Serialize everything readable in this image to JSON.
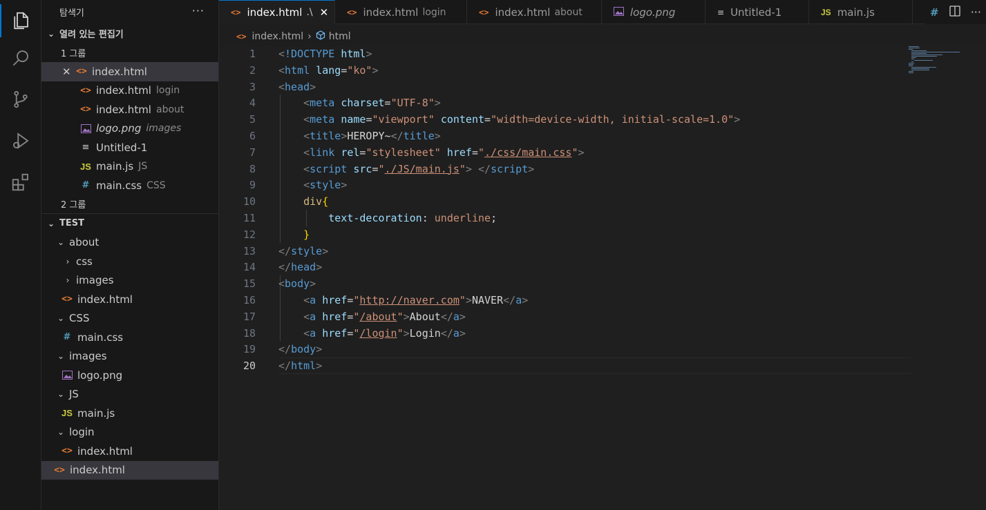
{
  "sidebar": {
    "title": "탐색기",
    "open_editors": {
      "header": "열려 있는 편집기",
      "group1": "1 그룹",
      "group2": "2 그룹",
      "items": [
        {
          "name": "index.html",
          "desc": "",
          "icon": "html-icon"
        },
        {
          "name": "index.html",
          "desc": "login",
          "icon": "html-icon"
        },
        {
          "name": "index.html",
          "desc": "about",
          "icon": "html-icon"
        },
        {
          "name": "logo.png",
          "desc": "images",
          "icon": "image-icon"
        },
        {
          "name": "Untitled-1",
          "desc": "",
          "icon": "text-file-icon"
        },
        {
          "name": "main.js",
          "desc": "JS",
          "icon": "js-icon"
        },
        {
          "name": "main.css",
          "desc": "CSS",
          "icon": "css-icon"
        }
      ]
    },
    "folder": {
      "header": "TEST",
      "items": [
        {
          "label": "about"
        },
        {
          "label": "css"
        },
        {
          "label": "images"
        },
        {
          "label": "index.html"
        },
        {
          "label": "CSS"
        },
        {
          "label": "main.css"
        },
        {
          "label": "images"
        },
        {
          "label": "logo.png"
        },
        {
          "label": "JS"
        },
        {
          "label": "main.js"
        },
        {
          "label": "login"
        },
        {
          "label": "index.html"
        },
        {
          "label": "index.html"
        }
      ]
    }
  },
  "tabs": [
    {
      "label": "index.html",
      "desc": ".\\",
      "icon": "html-icon"
    },
    {
      "label": "index.html",
      "desc": "login",
      "icon": "html-icon"
    },
    {
      "label": "index.html",
      "desc": "about",
      "icon": "html-icon"
    },
    {
      "label": "logo.png",
      "desc": "",
      "icon": "image-icon"
    },
    {
      "label": "Untitled-1",
      "desc": "",
      "icon": "text-file-icon"
    },
    {
      "label": "main.js",
      "desc": "",
      "icon": "js-icon"
    }
  ],
  "tab_icon_labels": {
    "html": "<>",
    "js": "JS",
    "css": "#",
    "txt": "≡",
    "close": "✕"
  },
  "breadcrumb": {
    "file": "index.html",
    "symbol": "html"
  },
  "editor": {
    "current_line": 20,
    "lines": [
      [
        [
          "t-punc",
          "<"
        ],
        [
          "t-tag",
          "!DOCTYPE"
        ],
        [
          "t-txt",
          " "
        ],
        [
          "t-attr",
          "html"
        ],
        [
          "t-punc",
          ">"
        ]
      ],
      [
        [
          "t-punc",
          "<"
        ],
        [
          "t-tag",
          "html"
        ],
        [
          "t-txt",
          " "
        ],
        [
          "t-attr",
          "lang"
        ],
        [
          "t-txt",
          "="
        ],
        [
          "t-str",
          "\"ko\""
        ],
        [
          "t-punc",
          ">"
        ]
      ],
      [
        [
          "t-punc",
          "<"
        ],
        [
          "t-tag",
          "head"
        ],
        [
          "t-punc",
          ">"
        ]
      ],
      [
        [
          "t-txt",
          "    "
        ],
        [
          "t-punc",
          "<"
        ],
        [
          "t-tag",
          "meta"
        ],
        [
          "t-txt",
          " "
        ],
        [
          "t-attr",
          "charset"
        ],
        [
          "t-txt",
          "="
        ],
        [
          "t-str",
          "\"UTF-8\""
        ],
        [
          "t-punc",
          ">"
        ]
      ],
      [
        [
          "t-txt",
          "    "
        ],
        [
          "t-punc",
          "<"
        ],
        [
          "t-tag",
          "meta"
        ],
        [
          "t-txt",
          " "
        ],
        [
          "t-attr",
          "name"
        ],
        [
          "t-txt",
          "="
        ],
        [
          "t-str",
          "\"viewport\""
        ],
        [
          "t-txt",
          " "
        ],
        [
          "t-attr",
          "content"
        ],
        [
          "t-txt",
          "="
        ],
        [
          "t-str",
          "\"width=device-width, initial-scale=1.0\""
        ],
        [
          "t-punc",
          ">"
        ]
      ],
      [
        [
          "t-txt",
          "    "
        ],
        [
          "t-punc",
          "<"
        ],
        [
          "t-tag",
          "title"
        ],
        [
          "t-punc",
          ">"
        ],
        [
          "t-txt",
          "HEROPY~"
        ],
        [
          "t-punc",
          "</"
        ],
        [
          "t-tag",
          "title"
        ],
        [
          "t-punc",
          ">"
        ]
      ],
      [
        [
          "t-txt",
          "    "
        ],
        [
          "t-punc",
          "<"
        ],
        [
          "t-tag",
          "link"
        ],
        [
          "t-txt",
          " "
        ],
        [
          "t-attr",
          "rel"
        ],
        [
          "t-txt",
          "="
        ],
        [
          "t-str",
          "\"stylesheet\""
        ],
        [
          "t-txt",
          " "
        ],
        [
          "t-attr",
          "href"
        ],
        [
          "t-txt",
          "="
        ],
        [
          "t-str",
          "\""
        ],
        [
          "t-str t-ul",
          "./css/main.css"
        ],
        [
          "t-str",
          "\""
        ],
        [
          "t-punc",
          ">"
        ]
      ],
      [
        [
          "t-txt",
          "    "
        ],
        [
          "t-punc",
          "<"
        ],
        [
          "t-tag",
          "script"
        ],
        [
          "t-txt",
          " "
        ],
        [
          "t-attr",
          "src"
        ],
        [
          "t-txt",
          "="
        ],
        [
          "t-str",
          "\""
        ],
        [
          "t-str t-ul",
          "./JS/main.js"
        ],
        [
          "t-str",
          "\""
        ],
        [
          "t-punc",
          ">"
        ],
        [
          "t-txt",
          " "
        ],
        [
          "t-punc",
          "</"
        ],
        [
          "t-tag",
          "script"
        ],
        [
          "t-punc",
          ">"
        ]
      ],
      [
        [
          "t-txt",
          "    "
        ],
        [
          "t-punc",
          "<"
        ],
        [
          "t-tag",
          "style"
        ],
        [
          "t-punc",
          ">"
        ]
      ],
      [
        [
          "t-txt",
          "    "
        ],
        [
          "t-sel",
          "div"
        ],
        [
          "t-brace",
          "{"
        ]
      ],
      [
        [
          "t-txt",
          "        "
        ],
        [
          "t-attr",
          "text-decoration"
        ],
        [
          "t-txt",
          ": "
        ],
        [
          "t-val",
          "underline"
        ],
        [
          "t-txt",
          ";"
        ]
      ],
      [
        [
          "t-txt",
          "    "
        ],
        [
          "t-brace",
          "}"
        ]
      ],
      [
        [
          "t-punc",
          "</"
        ],
        [
          "t-tag",
          "style"
        ],
        [
          "t-punc",
          ">"
        ]
      ],
      [
        [
          "t-punc",
          "</"
        ],
        [
          "t-tag",
          "head"
        ],
        [
          "t-punc",
          ">"
        ]
      ],
      [
        [
          "t-punc",
          "<"
        ],
        [
          "t-tag",
          "body"
        ],
        [
          "t-punc",
          ">"
        ]
      ],
      [
        [
          "t-txt",
          "    "
        ],
        [
          "t-punc",
          "<"
        ],
        [
          "t-tag",
          "a"
        ],
        [
          "t-txt",
          " "
        ],
        [
          "t-attr",
          "href"
        ],
        [
          "t-txt",
          "="
        ],
        [
          "t-str",
          "\""
        ],
        [
          "t-str t-ul",
          "http://naver.com"
        ],
        [
          "t-str",
          "\""
        ],
        [
          "t-punc",
          ">"
        ],
        [
          "t-txt",
          "NAVER"
        ],
        [
          "t-punc",
          "</"
        ],
        [
          "t-tag",
          "a"
        ],
        [
          "t-punc",
          ">"
        ]
      ],
      [
        [
          "t-txt",
          "    "
        ],
        [
          "t-punc",
          "<"
        ],
        [
          "t-tag",
          "a"
        ],
        [
          "t-txt",
          " "
        ],
        [
          "t-attr",
          "href"
        ],
        [
          "t-txt",
          "="
        ],
        [
          "t-str",
          "\""
        ],
        [
          "t-str t-ul",
          "/about"
        ],
        [
          "t-str",
          "\""
        ],
        [
          "t-punc",
          ">"
        ],
        [
          "t-txt",
          "About"
        ],
        [
          "t-punc",
          "</"
        ],
        [
          "t-tag",
          "a"
        ],
        [
          "t-punc",
          ">"
        ]
      ],
      [
        [
          "t-txt",
          "    "
        ],
        [
          "t-punc",
          "<"
        ],
        [
          "t-tag",
          "a"
        ],
        [
          "t-txt",
          " "
        ],
        [
          "t-attr",
          "href"
        ],
        [
          "t-txt",
          "="
        ],
        [
          "t-str",
          "\""
        ],
        [
          "t-str t-ul",
          "/login"
        ],
        [
          "t-str",
          "\""
        ],
        [
          "t-punc",
          ">"
        ],
        [
          "t-txt",
          "Login"
        ],
        [
          "t-punc",
          "</"
        ],
        [
          "t-tag",
          "a"
        ],
        [
          "t-punc",
          ">"
        ]
      ],
      [
        [
          "t-punc",
          "</"
        ],
        [
          "t-tag",
          "body"
        ],
        [
          "t-punc",
          ">"
        ]
      ],
      [
        [
          "t-punc",
          "</"
        ],
        [
          "t-tag",
          "html"
        ],
        [
          "t-punc",
          ">"
        ]
      ]
    ]
  },
  "colors": {
    "accent": "#0078d4",
    "html_icon": "#e37933",
    "js_icon": "#cbcb41",
    "css_icon": "#519aba",
    "image_icon": "#a074c4"
  }
}
